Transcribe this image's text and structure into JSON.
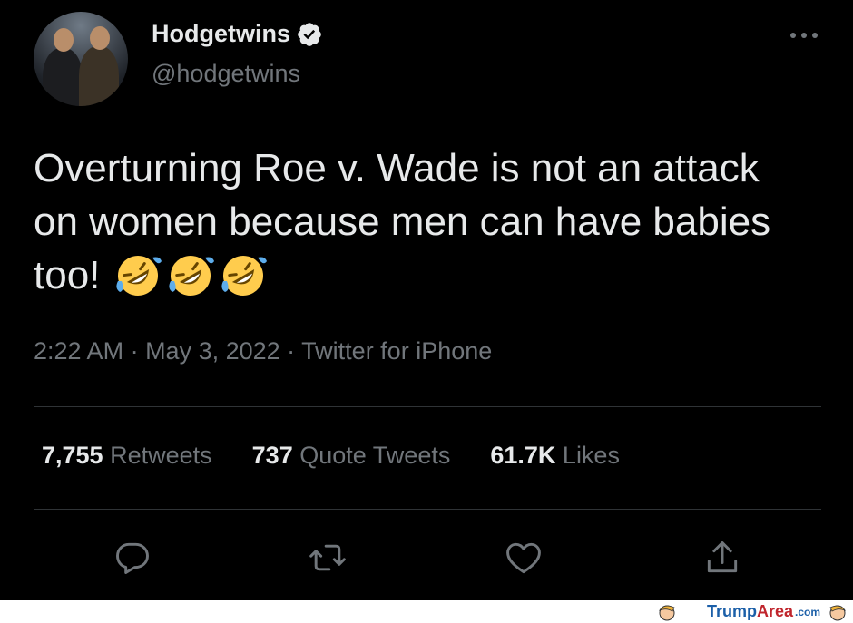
{
  "profile": {
    "name": "Hodgetwins",
    "handle": "@hodgetwins",
    "verified": true
  },
  "tweet": {
    "text": "Overturning Roe v. Wade is not an attack on women because men can have babies too!",
    "emoji": [
      "rolling-on-floor-laughing",
      "rolling-on-floor-laughing",
      "rolling-on-floor-laughing"
    ],
    "time": "2:22 AM",
    "separator": " · ",
    "date": "May 3, 2022",
    "source": "Twitter for iPhone"
  },
  "stats": {
    "retweets_value": "7,755",
    "retweets_label": "Retweets",
    "quotes_value": "737",
    "quotes_label": "Quote Tweets",
    "likes_value": "61.7K",
    "likes_label": "Likes"
  },
  "actions": [
    "reply-icon",
    "retweet-icon",
    "like-icon",
    "share-icon"
  ],
  "watermark": {
    "trump": "Trump",
    "area": "Area",
    "com": ".com"
  },
  "colors": {
    "background": "#000000",
    "text": "#e7e9ea",
    "muted": "#71767b",
    "divider": "#2f3336",
    "verified": "#e7e9ea"
  }
}
